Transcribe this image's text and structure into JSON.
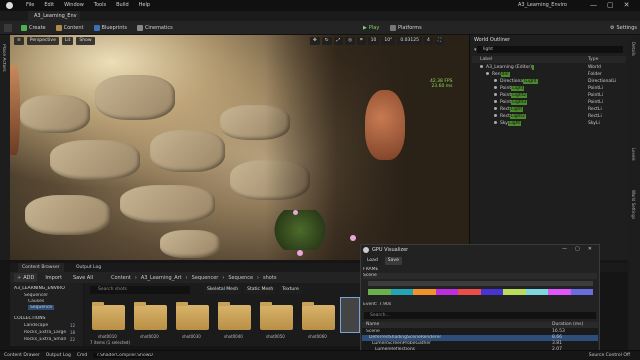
{
  "window": {
    "title": "A3_Learning_Enviro",
    "menu": [
      "File",
      "Edit",
      "Window",
      "Tools",
      "Build",
      "Help"
    ],
    "controls": [
      "—",
      "▢",
      "✕"
    ]
  },
  "level_tab": "A3_Learning_Env",
  "toolbar": {
    "create": "Create",
    "content": "Content",
    "blueprints": "Blueprints",
    "cinematics": "Cinematics",
    "play": "Play",
    "platforms": "Platforms",
    "settings": "Settings"
  },
  "left_strip": {
    "place_actors": "Place Actors"
  },
  "viewport": {
    "perspective": "Perspective",
    "lit": "Lit",
    "show": "Show",
    "snap_value": "10",
    "rotation_value": "10°",
    "scale_value": "0.03125",
    "camera_speed": "4",
    "stats_fps": "42.38 FPS",
    "stats_ms": "23.60 ms"
  },
  "outliner": {
    "title": "World Outliner",
    "search_value": "light",
    "col_label": "Label",
    "col_type": "Type",
    "rows": [
      {
        "name": "A3_Learning (Editor)",
        "hl": "",
        "type": "World"
      },
      {
        "name": "Ren",
        "hl": "der",
        "type": "Folder"
      },
      {
        "name": "Directiona",
        "hl": "lLight",
        "type": "DirectionalLi"
      },
      {
        "name": "Point",
        "hl": "Light",
        "type": "PointLi"
      },
      {
        "name": "Point",
        "hl": "Light2",
        "type": "PointLi"
      },
      {
        "name": "Point",
        "hl": "Light3",
        "type": "PointLi"
      },
      {
        "name": "Rect",
        "hl": "Light",
        "type": "RectLi"
      },
      {
        "name": "Rect",
        "hl": "Light2",
        "type": "RectLi"
      },
      {
        "name": "Sky",
        "hl": "Light",
        "type": "SkyLi"
      }
    ],
    "side_tabs": [
      "Details",
      "Levels",
      "World Settings"
    ]
  },
  "content_browser": {
    "tab_content": "Content Browser",
    "tab_output": "Output Log",
    "add": "ADD",
    "import": "Import",
    "save_all": "Save All",
    "breadcrumb": [
      "Content",
      "A3_Learning_Art",
      "Sequencer",
      "Sequence",
      "shots"
    ],
    "search_placeholder": "Search shots",
    "filters": [
      "Skeletal Mesh",
      "Static Mesh",
      "Texture"
    ],
    "tree_root": "A3_LEARNING_ENVIRO",
    "tree_items": [
      "Sequencer",
      "Causes",
      "Sequence"
    ],
    "collections_header": "COLLECTIONS",
    "collections": [
      {
        "name": "Landscape",
        "count": "12"
      },
      {
        "name": "Rocks_Extra_Large",
        "count": "18"
      },
      {
        "name": "Rocks_Extra_Small",
        "count": "22"
      }
    ],
    "folders": [
      "shot0010",
      "shot0020",
      "shot0030",
      "shot0040",
      "shot0050",
      "shot0060"
    ],
    "item_count": "7 items (1 selected)"
  },
  "gpu_visualizer": {
    "title": "GPU Visualizer",
    "load": "Load",
    "save": "Save",
    "frame_label": "FRAME",
    "scene_label": "Scene",
    "event_label": "Event: 7.90s",
    "search_placeholder": "Search...",
    "col_name": "Name",
    "col_duration": "Duration (ms)",
    "rows": [
      {
        "name": "Scene",
        "value": "16.53"
      },
      {
        "name": "DeferredShadingSceneRenderer",
        "value": "8.66"
      },
      {
        "name": "LumenScreenProbeGather",
        "value": "3.81"
      },
      {
        "name": "LumenReflections",
        "value": "2.07"
      }
    ],
    "bar_colors": [
      "#6ab04c",
      "#22a6b3",
      "#f0932b",
      "#be2edd",
      "#eb4d4b",
      "#4834d4",
      "#badc58",
      "#7ed6df",
      "#e056fd",
      "#686de0"
    ]
  },
  "status_bar": {
    "content_drawer": "Content Drawer",
    "output_log": "Output Log",
    "cmd": "Cmd",
    "cmd_value": "r.ShaderCompiler.ShowDebug",
    "source_control": "Source Control Off"
  }
}
